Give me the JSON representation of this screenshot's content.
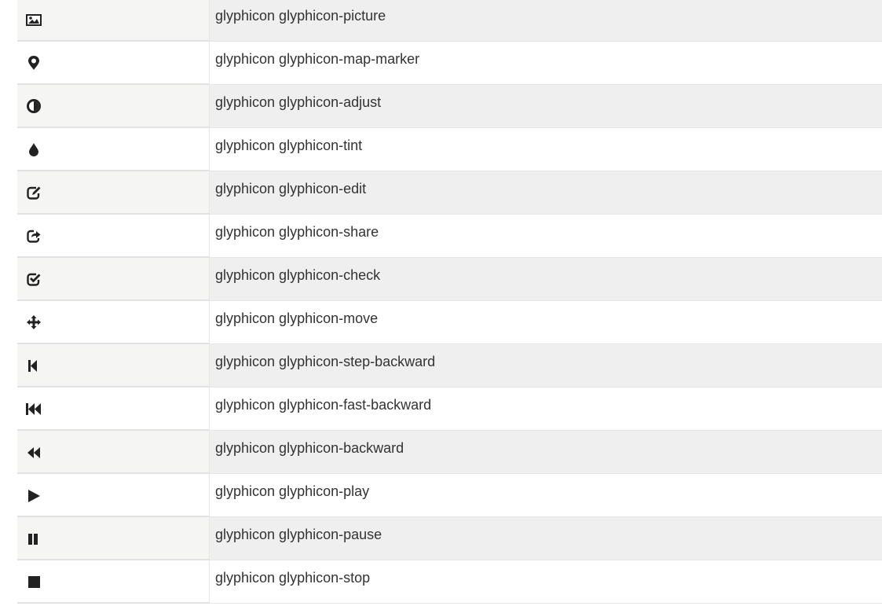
{
  "rows": [
    {
      "icon": "picture-icon",
      "label": "glyphicon glyphicon-picture"
    },
    {
      "icon": "map-marker-icon",
      "label": "glyphicon glyphicon-map-marker"
    },
    {
      "icon": "adjust-icon",
      "label": "glyphicon glyphicon-adjust"
    },
    {
      "icon": "tint-icon",
      "label": "glyphicon glyphicon-tint"
    },
    {
      "icon": "edit-icon",
      "label": "glyphicon glyphicon-edit"
    },
    {
      "icon": "share-icon",
      "label": "glyphicon glyphicon-share"
    },
    {
      "icon": "check-icon",
      "label": "glyphicon glyphicon-check"
    },
    {
      "icon": "move-icon",
      "label": "glyphicon glyphicon-move"
    },
    {
      "icon": "step-backward-icon",
      "label": "glyphicon glyphicon-step-backward"
    },
    {
      "icon": "fast-backward-icon",
      "label": "glyphicon glyphicon-fast-backward"
    },
    {
      "icon": "backward-icon",
      "label": "glyphicon glyphicon-backward"
    },
    {
      "icon": "play-icon",
      "label": "glyphicon glyphicon-play"
    },
    {
      "icon": "pause-icon",
      "label": "glyphicon glyphicon-pause"
    },
    {
      "icon": "stop-icon",
      "label": "glyphicon glyphicon-stop"
    }
  ]
}
